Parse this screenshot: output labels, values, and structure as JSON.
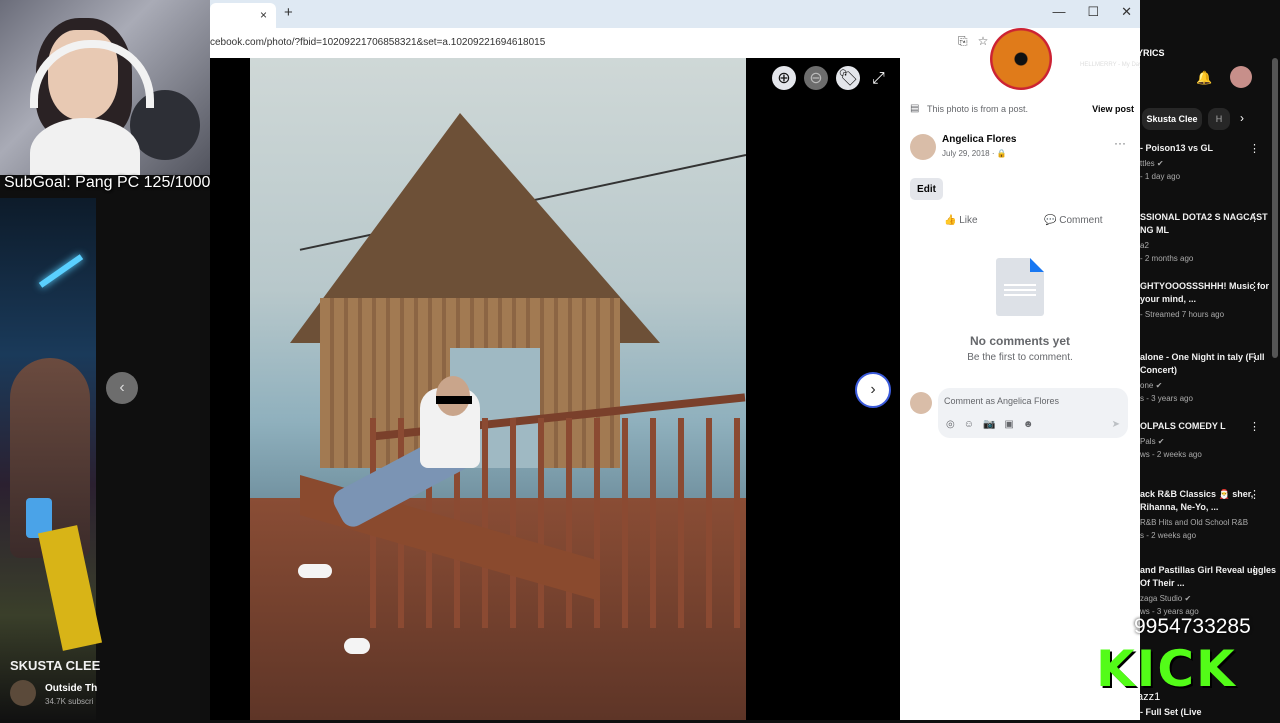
{
  "overlay": {
    "subgoal": "SubGoal: Pang PC 125/1000",
    "kick_number": "9954733285",
    "kick_logo": "KICK",
    "kick_user": "Bayazz1",
    "goldy_title": "GOLDY LYRICS",
    "goldy_song": "HELLMERRY - My Day (Lyrics)"
  },
  "left_stream": {
    "title": "SKUSTA CLEE",
    "channel": "Outside Th",
    "subs": "34.7K subscri"
  },
  "browser": {
    "url": "cebook.com/photo/?fbid=10209221706858321&set=a.10209221694618015",
    "new_tab": "+",
    "tab_close": "×",
    "window_controls": [
      "—",
      "☐",
      "✕"
    ]
  },
  "viewer": {
    "prev_icon": "‹",
    "next_icon": "›",
    "zoom_in_icon": "⊕",
    "zoom_out_icon": "⊖",
    "tag_icon": "🏷",
    "fullscreen_icon": "⤢"
  },
  "post": {
    "from_post": "This photo is from a post.",
    "view_post": "View post",
    "author": "Angelica Flores",
    "date": "July 29, 2018 · 🔒",
    "more": "···",
    "edit": "Edit",
    "like": "👍 Like",
    "comment": "💬 Comment",
    "no_comments_title": "No comments yet",
    "no_comments_sub": "Be the first to comment.",
    "comment_placeholder": "Comment as Angelica Flores",
    "comment_icons": [
      "◎",
      "☺",
      "📷",
      "▣",
      "☻"
    ],
    "send_icon": "➤"
  },
  "youtube": {
    "chip1": "Skusta Clee",
    "chip2": "H",
    "chip_next": "›",
    "items": [
      {
        "title": "- Poison13 vs GL",
        "channel": "ttles ✔",
        "meta": "- 1 day ago"
      },
      {
        "title": "SSIONAL DOTA2 S NAGCAST NG ML",
        "channel": "a2",
        "meta": "- 2 months ago"
      },
      {
        "title": "GHTYOOOSSSHHH! Music for your mind, ...",
        "channel": "",
        "meta": "- Streamed 7 hours ago"
      },
      {
        "title": "alone - One Night in taly (Full Concert)",
        "channel": "one ✔",
        "meta": "s - 3 years ago"
      },
      {
        "title": "OLPALS COMEDY L",
        "channel": "Pals ✔",
        "meta": "ws - 2 weeks ago"
      },
      {
        "title": "ack R&B Classics 🎅 sher, Rihanna, Ne-Yo, ...",
        "channel": "R&B Hits and Old School R&B",
        "meta": "s - 2 weeks ago"
      },
      {
        "title": "and Pastillas Girl Reveal uggles Of Their ...",
        "channel": "zaga Studio ✔",
        "meta": "ws - 3 years ago"
      },
      {
        "title": "- Full Set (Live",
        "channel": "",
        "meta": ""
      }
    ]
  }
}
